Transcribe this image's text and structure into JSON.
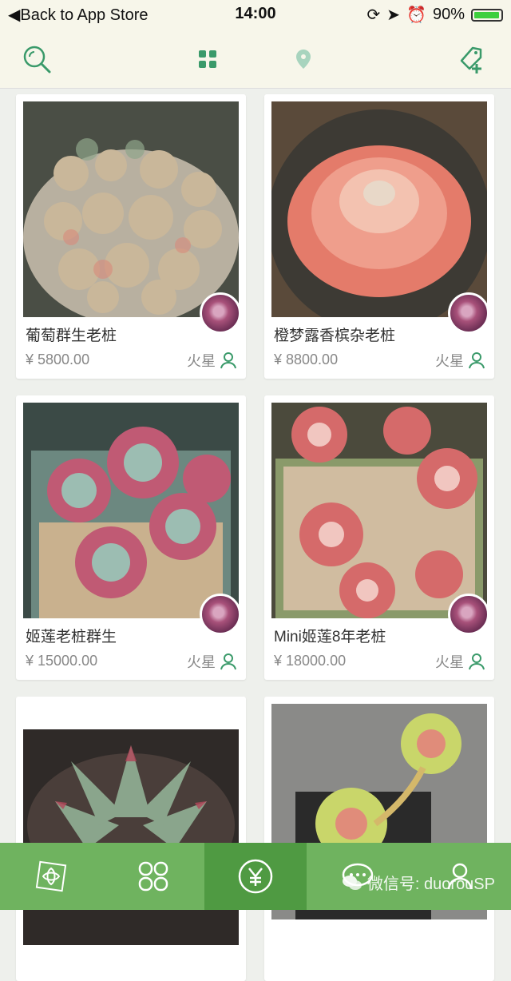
{
  "status": {
    "back": "Back to App Store",
    "time": "14:00",
    "battery": "90%",
    "battery_level": 0.9
  },
  "icons": {
    "search": "search-icon",
    "grid": "grid-icon",
    "location": "location-pin-icon",
    "add_tag": "add-tag-icon"
  },
  "colors": {
    "accent": "#3a9a6a",
    "tabbar": "#6fb35f",
    "tab_active": "#4f9a42",
    "card_title": "#333333",
    "price": "#888888"
  },
  "products": [
    {
      "title": "葡萄群生老桩",
      "price": "¥ 5800.00",
      "seller": "火星"
    },
    {
      "title": "橙梦露香槟杂老桩",
      "price": "¥ 8800.00",
      "seller": "火星"
    },
    {
      "title": "姬莲老桩群生",
      "price": "¥ 15000.00",
      "seller": "火星"
    },
    {
      "title": "Mini姬莲8年老桩",
      "price": "¥ 18000.00",
      "seller": "火星"
    },
    {
      "title": "",
      "price": "",
      "seller": ""
    },
    {
      "title": "",
      "price": "",
      "seller": ""
    }
  ],
  "tabbar": {
    "active_index": 2,
    "watermark": "微信号: duorouSP"
  }
}
